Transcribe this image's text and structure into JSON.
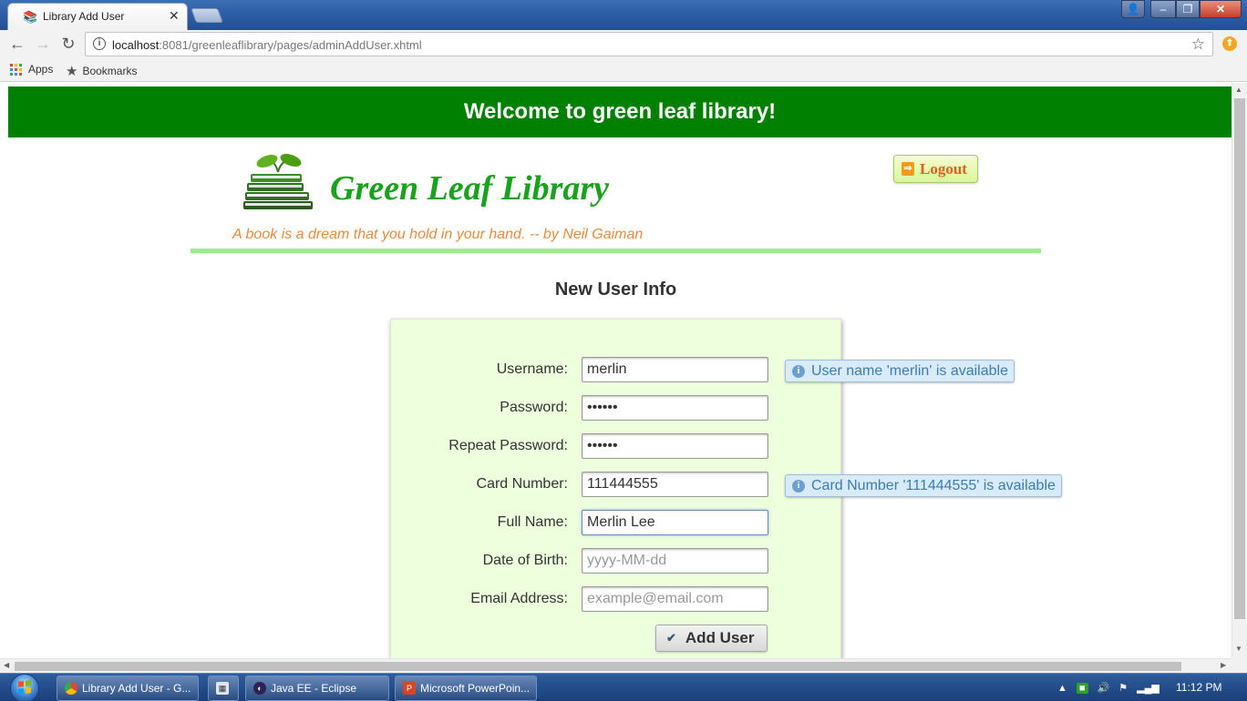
{
  "browser": {
    "tab_title": "Library Add User",
    "tab_close": "✕",
    "url_host": "localhost",
    "url_path": ":8081/greenleaflibrary/pages/adminAddUser.xhtml",
    "window_close": "✕",
    "window_min": "–",
    "window_max": "❐",
    "window_user": "👤"
  },
  "bookmarks": {
    "apps_label": "Apps",
    "bookmarks_label": "Bookmarks"
  },
  "page": {
    "banner": "Welcome to green leaf library!",
    "brand": "Green Leaf Library",
    "quote": "A book is a dream that you hold in your hand. -- by Neil Gaiman",
    "logout_label": "Logout",
    "form_title": "New User Info",
    "form": {
      "username": {
        "label": "Username:",
        "value": "merlin",
        "message": "User name 'merlin' is available"
      },
      "password": {
        "label": "Password:",
        "value": "merlin"
      },
      "repeat_password": {
        "label": "Repeat Password:",
        "value": "merlin"
      },
      "card_number": {
        "label": "Card Number:",
        "value": "111444555",
        "message": "Card Number '111444555' is available"
      },
      "full_name": {
        "label": "Full Name:",
        "value": "Merlin Lee"
      },
      "dob": {
        "label": "Date of Birth:",
        "value": "",
        "placeholder": "yyyy-MM-dd"
      },
      "email": {
        "label": "Email Address:",
        "value": "",
        "placeholder": "example@email.com"
      },
      "submit_label": "Add User"
    },
    "colors": {
      "banner": "#008000",
      "brand": "#19a21b",
      "quote": "#e98a3f",
      "panel": "#eeffdd"
    }
  },
  "taskbar": {
    "tasks": [
      {
        "label": "Library Add User - G..."
      },
      {
        "label": ""
      },
      {
        "label": "Java EE - Eclipse"
      },
      {
        "label": "Microsoft PowerPoin..."
      }
    ],
    "clock": "11:12 PM"
  }
}
